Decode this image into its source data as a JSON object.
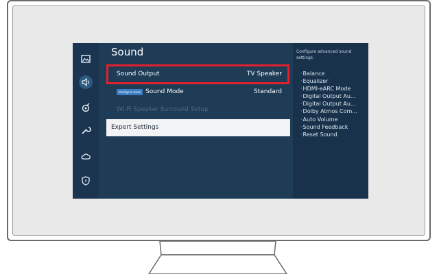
{
  "screen": {
    "title": "Sound",
    "rail_icons": [
      "picture-icon",
      "sound-icon",
      "broadcast-icon",
      "wrench-icon",
      "cloud-icon",
      "shield-icon"
    ],
    "menu": [
      {
        "label": "Sound Output",
        "value": "TV Speaker"
      },
      {
        "badge": "Intelligent mode",
        "label": "Sound Mode",
        "value": "Standard"
      },
      {
        "label": "Wi-Fi Speaker Surround Setup"
      },
      {
        "label": "Expert Settings"
      }
    ],
    "side_panel": {
      "description": "Configure advanced sound settings.",
      "items": [
        "Balance",
        "Equalizer",
        "HDMI-eARC Mode",
        "Digital Output Au...",
        "Digital Output Au...",
        "Dolby Atmos Com...",
        "Auto Volume",
        "Sound Feedback",
        "Reset Sound"
      ]
    },
    "colors": {
      "highlight": "#e3202b",
      "background": "#1f3c57"
    }
  }
}
